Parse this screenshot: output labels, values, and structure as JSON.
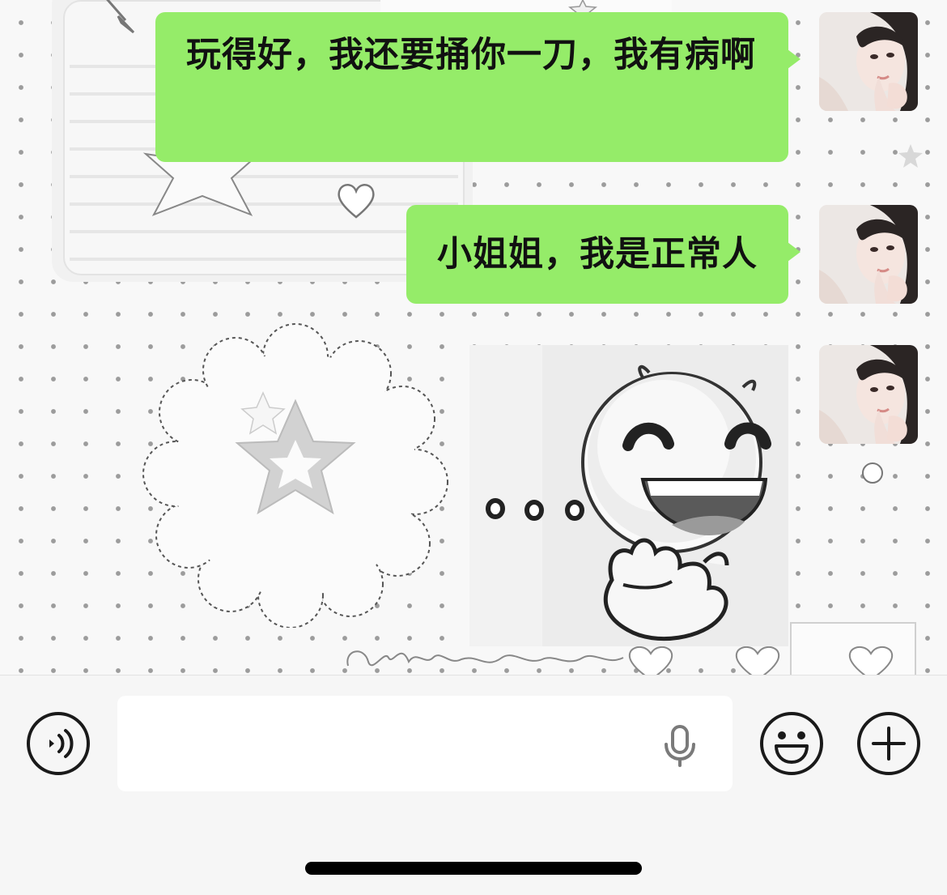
{
  "messages": [
    {
      "type": "text",
      "text": "玩得好，我还要捅你一刀，我有病啊",
      "sender": "self"
    },
    {
      "type": "text",
      "text": "小姐姐，我是正常人",
      "sender": "self"
    },
    {
      "type": "sticker",
      "description": "sticker",
      "sender": "self"
    }
  ],
  "colors": {
    "bubble": "#95ec69",
    "bubble_text": "#111111",
    "wallpaper": "#f8f8f8",
    "input_bar": "#f6f6f6",
    "input_field": "#ffffff",
    "icon_stroke": "#1a1a1a"
  },
  "input_bar": {
    "voice_icon": "voice-mode-icon",
    "input_value": "",
    "mic_icon": "microphone-icon",
    "emoji_icon": "emoji-smiley-icon",
    "plus_icon": "plus-icon"
  }
}
